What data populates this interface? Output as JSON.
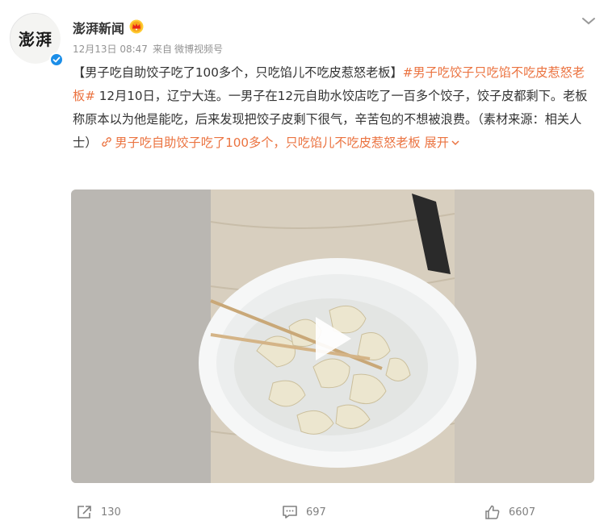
{
  "author": {
    "name": "澎湃新闻",
    "avatar_text": "澎湃",
    "verified_icon": "verified-badge-icon",
    "member_icon": "crown-icon"
  },
  "meta": {
    "time": "12月13日 08:47",
    "source_prefix": "来自",
    "source": "微博视频号"
  },
  "post": {
    "title": "【男子吃自助饺子吃了100多个，只吃馅儿不吃皮惹怒老板】",
    "hashtag": "#男子吃饺子只吃馅不吃皮惹怒老板#",
    "body": " 12月10日，辽宁大连。一男子在12元自助水饺店吃了一百多个饺子，饺子皮都剩下。老板称原本以为他是能吃，后来发现把饺子皮剩下很气，辛苦包的不想被浪费。（素材来源：相关人士）",
    "video_link": "男子吃自助饺子吃了100多个，只吃馅儿不吃皮惹怒老板",
    "expand_label": "展开"
  },
  "actions": {
    "repost_count": "130",
    "comment_count": "697",
    "like_count": "6607"
  },
  "colors": {
    "link": "#eb7340",
    "verified": "#1b8ee8",
    "text": "#333333",
    "meta": "#939393"
  }
}
